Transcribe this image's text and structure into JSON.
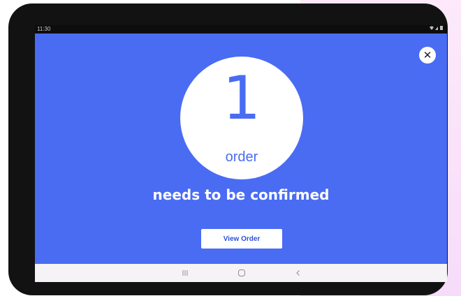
{
  "status_bar": {
    "time": "11:30",
    "icons": "wifi-icon signal-icon battery-icon"
  },
  "close_button": {
    "icon": "close-icon",
    "glyph": "✕"
  },
  "order_badge": {
    "count": "1",
    "label": "order"
  },
  "message": "needs to be confirmed",
  "view_order_button": {
    "label": "View Order"
  },
  "nav_bar": {
    "recent_apps": "recent-apps-icon",
    "home": "home-icon",
    "back": "back-icon"
  },
  "colors": {
    "screen_background": "#4a6cf3",
    "accent_text": "#4a6cf3",
    "button_text": "#2f4fd8",
    "tablet_frame": "#121212",
    "nav_bar": "#f6f3f7",
    "page_background_right": "#fde9fb"
  }
}
